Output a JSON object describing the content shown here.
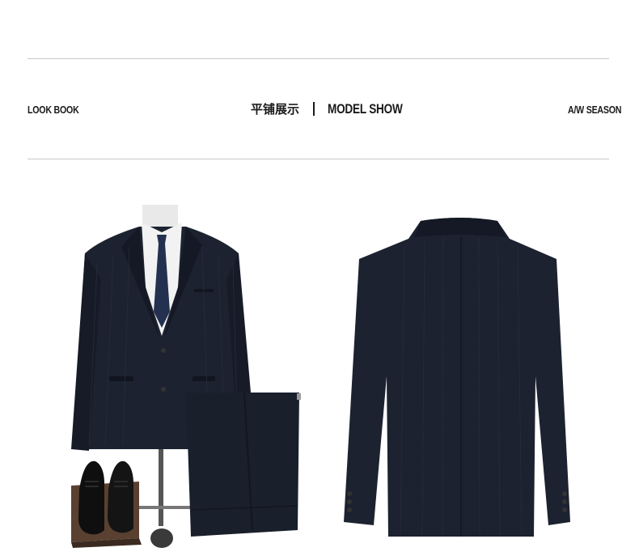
{
  "header": {
    "left_label": "LOOK BOOK",
    "center_cn": "平铺展示",
    "center_en": "MODEL SHOW",
    "right_label": "A/W SEASON"
  },
  "colors": {
    "suit": "#1c2230",
    "rule": "#c9c9c9",
    "text": "#1a1a1a"
  },
  "images": {
    "front": "suit-front-with-trousers-and-shoes",
    "back": "suit-jacket-back"
  }
}
